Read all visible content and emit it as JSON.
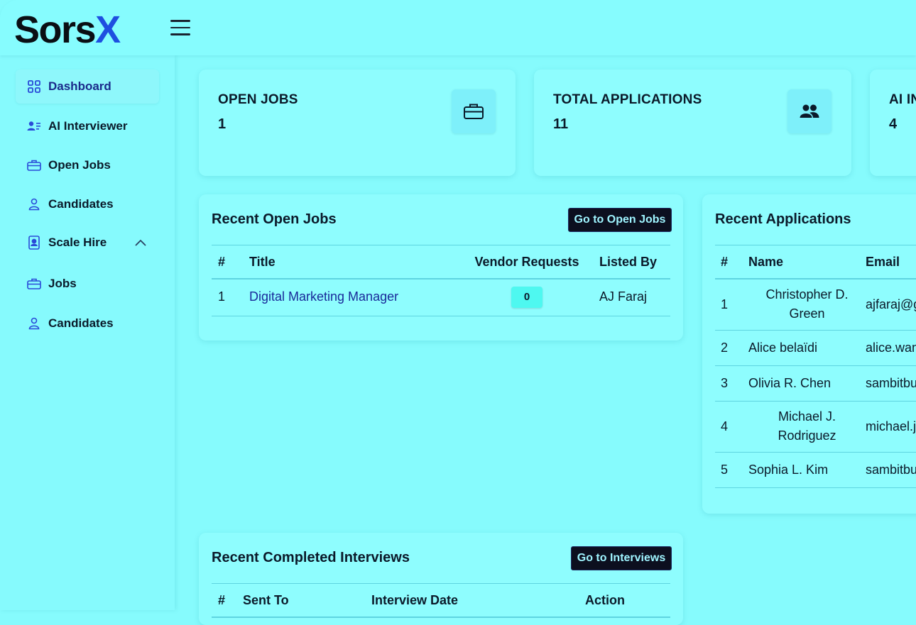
{
  "app": {
    "logo_main": "Sors",
    "logo_x": "X"
  },
  "sidebar": {
    "items": [
      {
        "label": "Dashboard",
        "icon": "grid-icon",
        "active": true
      },
      {
        "label": "AI Interviewer",
        "icon": "user-list-icon"
      },
      {
        "label": "Open Jobs",
        "icon": "briefcase-icon"
      },
      {
        "label": "Candidates",
        "icon": "user-icon"
      },
      {
        "label": "Scale Hire",
        "icon": "badge-icon",
        "expanded": true
      },
      {
        "label": "Jobs",
        "icon": "briefcase-icon"
      },
      {
        "label": "Candidates",
        "icon": "user-icon"
      }
    ]
  },
  "stats": [
    {
      "label": "OPEN JOBS",
      "value": "1",
      "icon": "briefcase-icon"
    },
    {
      "label": "TOTAL APPLICATIONS",
      "value": "11",
      "icon": "users-icon"
    },
    {
      "label": "AI IN",
      "value": "4"
    }
  ],
  "recent_jobs": {
    "title": "Recent Open Jobs",
    "button": "Go to Open Jobs",
    "columns": [
      "#",
      "Title",
      "Vendor Requests",
      "Listed By"
    ],
    "rows": [
      {
        "num": "1",
        "title": "Digital Marketing Manager",
        "vendor_requests": "0",
        "listed_by": "AJ Faraj"
      }
    ]
  },
  "recent_applications": {
    "title": "Recent Applications",
    "columns": [
      "#",
      "Name",
      "Email"
    ],
    "rows": [
      {
        "num": "1",
        "name": "Christopher D. Green",
        "email": "ajfaraj@g"
      },
      {
        "num": "2",
        "name": "Alice belaïdi",
        "email": "alice.wan"
      },
      {
        "num": "3",
        "name": "Olivia R. Chen",
        "email": "sambitbu"
      },
      {
        "num": "4",
        "name": "Michael J. Rodriguez",
        "email": "michael.j."
      },
      {
        "num": "5",
        "name": "Sophia L. Kim",
        "email": "sambitbu"
      }
    ]
  },
  "recent_interviews": {
    "title": "Recent Completed Interviews",
    "button": "Go to Interviews",
    "columns": [
      "#",
      "Sent To",
      "Interview Date",
      "Action"
    ]
  }
}
